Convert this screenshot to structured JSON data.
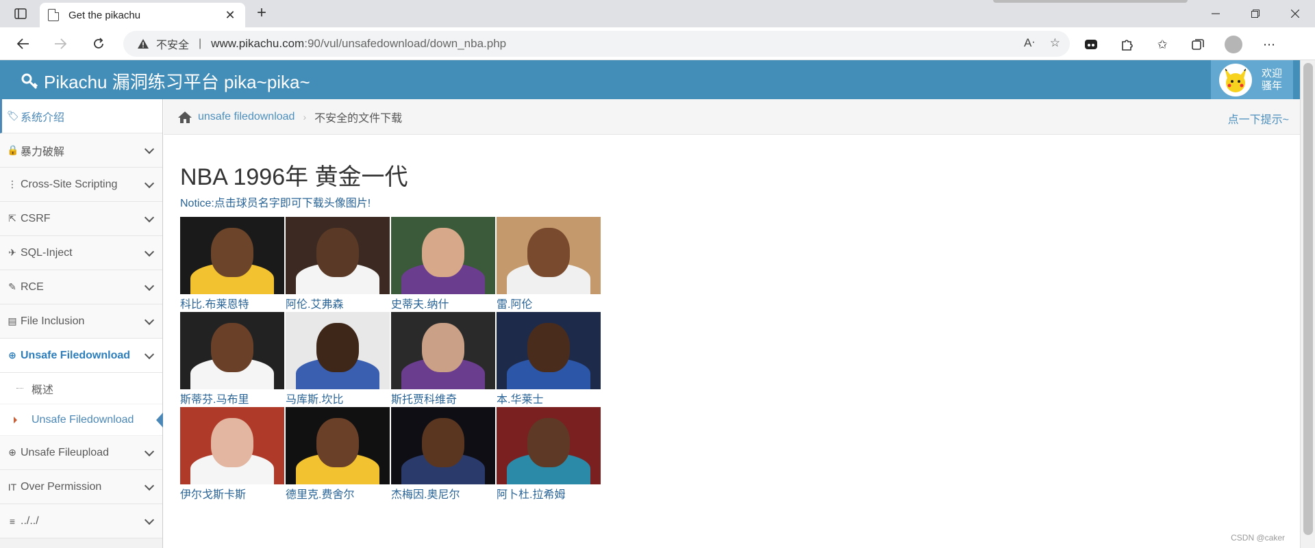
{
  "browser": {
    "tab_title": "Get the pikachu",
    "security_label": "不安全",
    "url_host": "www.pikachu.com",
    "url_rest": ":90/vul/unsafedownload/down_nba.php"
  },
  "header": {
    "title": "Pikachu 漏洞练习平台 pika~pika~",
    "greeting_line1": "欢迎",
    "greeting_line2": "骚年"
  },
  "sidebar": {
    "items": [
      {
        "label": "系统介绍",
        "icon": "tag-icon"
      },
      {
        "label": "暴力破解",
        "icon": "lock-icon"
      },
      {
        "label": "Cross-Site Scripting",
        "icon": "sitemap-icon"
      },
      {
        "label": "CSRF",
        "icon": "share-icon"
      },
      {
        "label": "SQL-Inject",
        "icon": "plane-icon"
      },
      {
        "label": "RCE",
        "icon": "pencil-icon"
      },
      {
        "label": "File Inclusion",
        "icon": "file-icon"
      },
      {
        "label": "Unsafe Filedownload",
        "icon": "download-icon"
      },
      {
        "label": "Unsafe Fileupload",
        "icon": "upload-icon"
      },
      {
        "label": "Over Permission",
        "icon": "text-height-icon"
      },
      {
        "label": "../../",
        "icon": "align-left-icon"
      }
    ],
    "sub_items": [
      {
        "label": "概述"
      },
      {
        "label": "Unsafe Filedownload"
      }
    ]
  },
  "breadcrumb": {
    "link": "unsafe filedownload",
    "current": "不安全的文件下载",
    "hint": "点一下提示~"
  },
  "main": {
    "title": "NBA 1996年 黄金一代",
    "notice": "Notice:点击球员名字即可下载头像图片!",
    "players": [
      {
        "name": "科比.布莱恩特",
        "bg": "#1a1a1a",
        "skin": "#6b4429",
        "jersey": "#f2c230"
      },
      {
        "name": "阿伦.艾弗森",
        "bg": "#3c2a22",
        "skin": "#5a3a26",
        "jersey": "#f4f4f4"
      },
      {
        "name": "史蒂夫.纳什",
        "bg": "#3a5a3a",
        "skin": "#d8a88a",
        "jersey": "#6a3d8f"
      },
      {
        "name": "雷.阿伦",
        "bg": "#c49a6c",
        "skin": "#7a4a2e",
        "jersey": "#f0f0f0"
      },
      {
        "name": "斯蒂芬.马布里",
        "bg": "#222222",
        "skin": "#6a4028",
        "jersey": "#f5f5f5"
      },
      {
        "name": "马库斯.坎比",
        "bg": "#e8e8e8",
        "skin": "#3e2618",
        "jersey": "#3a5fb0"
      },
      {
        "name": "斯托贾科维奇",
        "bg": "#2a2a2a",
        "skin": "#caa086",
        "jersey": "#6a3d8f"
      },
      {
        "name": "本.华莱士",
        "bg": "#1e2a4a",
        "skin": "#4a2c1c",
        "jersey": "#2c56a8"
      },
      {
        "name": "伊尔戈斯卡斯",
        "bg": "#b03a2a",
        "skin": "#e2b6a0",
        "jersey": "#f5f5f5"
      },
      {
        "name": "德里克.费舍尔",
        "bg": "#111111",
        "skin": "#6a4028",
        "jersey": "#f2c230"
      },
      {
        "name": "杰梅因.奥尼尔",
        "bg": "#0e0e14",
        "skin": "#5a3620",
        "jersey": "#2a3a6a"
      },
      {
        "name": "阿卜杜.拉希姆",
        "bg": "#7a2020",
        "skin": "#5e3a26",
        "jersey": "#2a8aa8"
      }
    ]
  },
  "footer": {
    "watermark": "CSDN @caker"
  },
  "colors": {
    "header_bg": "#438eb9",
    "link": "#2a6496",
    "accent": "#4b88b7"
  }
}
